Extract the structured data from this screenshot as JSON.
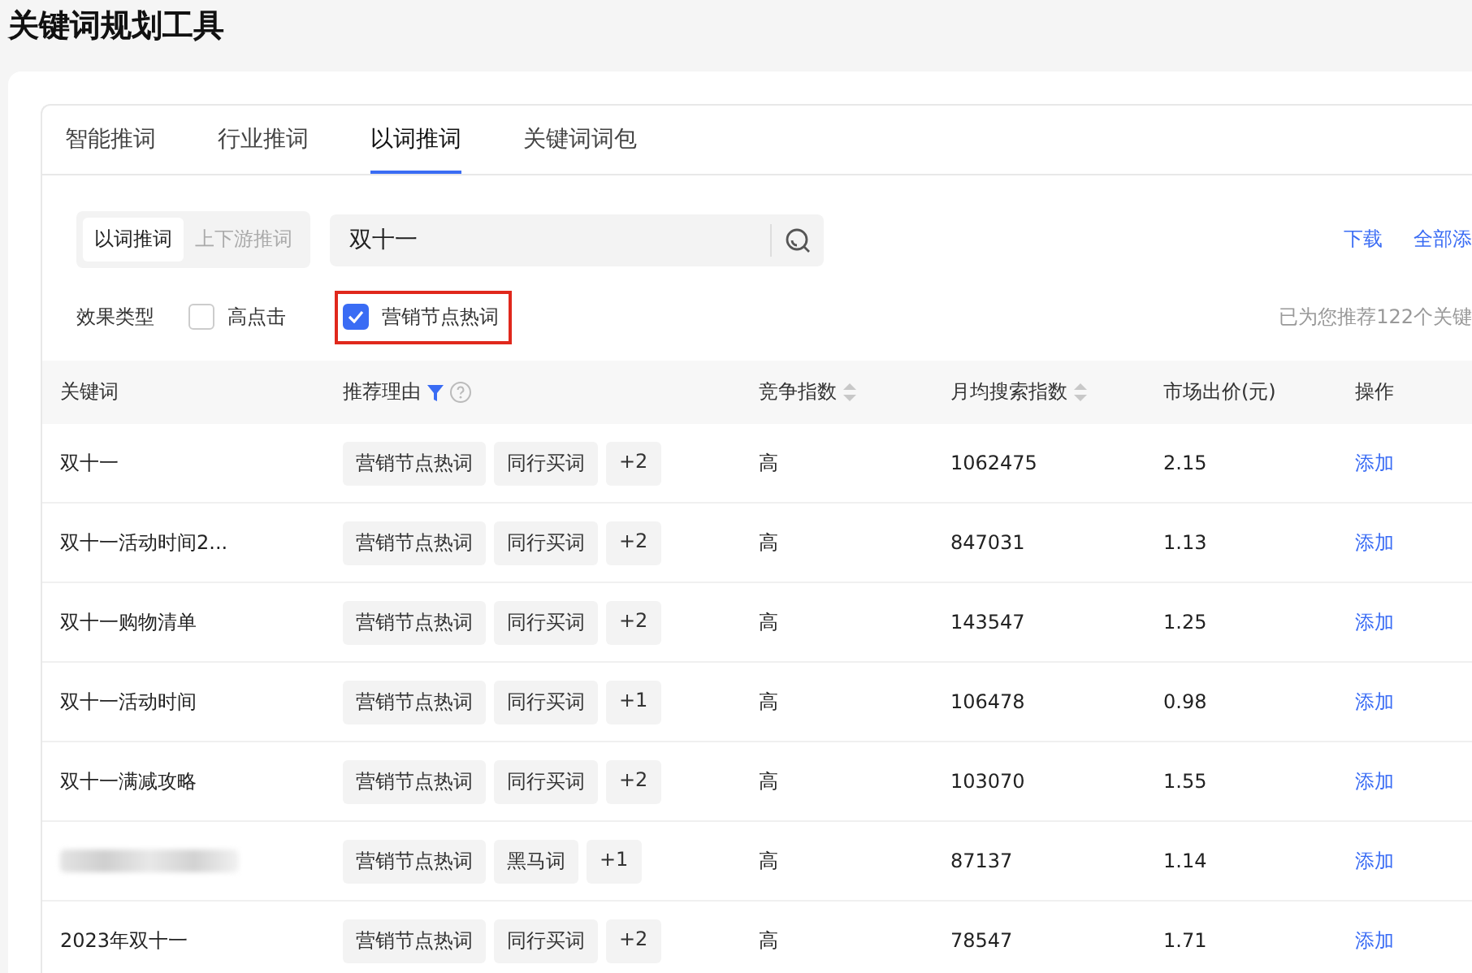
{
  "page_title": "关键词规划工具",
  "tabs": [
    {
      "label": "智能推词",
      "selected": false
    },
    {
      "label": "行业推词",
      "selected": false
    },
    {
      "label": "以词推词",
      "selected": true
    },
    {
      "label": "关键词词包",
      "selected": false
    }
  ],
  "mode_switch": [
    {
      "label": "以词推词",
      "selected": true
    },
    {
      "label": "上下游推词",
      "selected": false
    }
  ],
  "search": {
    "value": "双十一"
  },
  "actions": [
    "下载",
    "全部添"
  ],
  "filter": {
    "label": "效果类型",
    "options": [
      {
        "label": "高点击",
        "checked": false,
        "highlighted": false
      },
      {
        "label": "营销节点热词",
        "checked": true,
        "highlighted": true
      }
    ]
  },
  "result_note": "已为您推荐122个关键",
  "table": {
    "columns": [
      {
        "label": "关键词",
        "sortable": false,
        "filter": false,
        "help": false
      },
      {
        "label": "推荐理由",
        "sortable": false,
        "filter": true,
        "help": true
      },
      {
        "label": "竞争指数",
        "sortable": true,
        "filter": false,
        "help": false
      },
      {
        "label": "月均搜索指数",
        "sortable": true,
        "filter": false,
        "help": false
      },
      {
        "label": "市场出价(元)",
        "sortable": false,
        "filter": false,
        "help": false
      },
      {
        "label": "操作",
        "sortable": false,
        "filter": false,
        "help": false
      }
    ],
    "rows": [
      {
        "keyword": "双十一",
        "redacted": false,
        "tags": [
          "营销节点热词",
          "同行买词",
          "+2"
        ],
        "competition": "高",
        "search_index": "1062475",
        "price": "2.15",
        "action": "添加"
      },
      {
        "keyword": "双十一活动时间2...",
        "redacted": false,
        "tags": [
          "营销节点热词",
          "同行买词",
          "+2"
        ],
        "competition": "高",
        "search_index": "847031",
        "price": "1.13",
        "action": "添加"
      },
      {
        "keyword": "双十一购物清单",
        "redacted": false,
        "tags": [
          "营销节点热词",
          "同行买词",
          "+2"
        ],
        "competition": "高",
        "search_index": "143547",
        "price": "1.25",
        "action": "添加"
      },
      {
        "keyword": "双十一活动时间",
        "redacted": false,
        "tags": [
          "营销节点热词",
          "同行买词",
          "+1"
        ],
        "competition": "高",
        "search_index": "106478",
        "price": "0.98",
        "action": "添加"
      },
      {
        "keyword": "双十一满减攻略",
        "redacted": false,
        "tags": [
          "营销节点热词",
          "同行买词",
          "+2"
        ],
        "competition": "高",
        "search_index": "103070",
        "price": "1.55",
        "action": "添加"
      },
      {
        "keyword": "",
        "redacted": true,
        "tags": [
          "营销节点热词",
          "黑马词",
          "+1"
        ],
        "competition": "高",
        "search_index": "87137",
        "price": "1.14",
        "action": "添加"
      },
      {
        "keyword": "2023年双十一",
        "redacted": false,
        "tags": [
          "营销节点热词",
          "同行买词",
          "+2"
        ],
        "competition": "高",
        "search_index": "78547",
        "price": "1.71",
        "action": "添加"
      }
    ]
  }
}
